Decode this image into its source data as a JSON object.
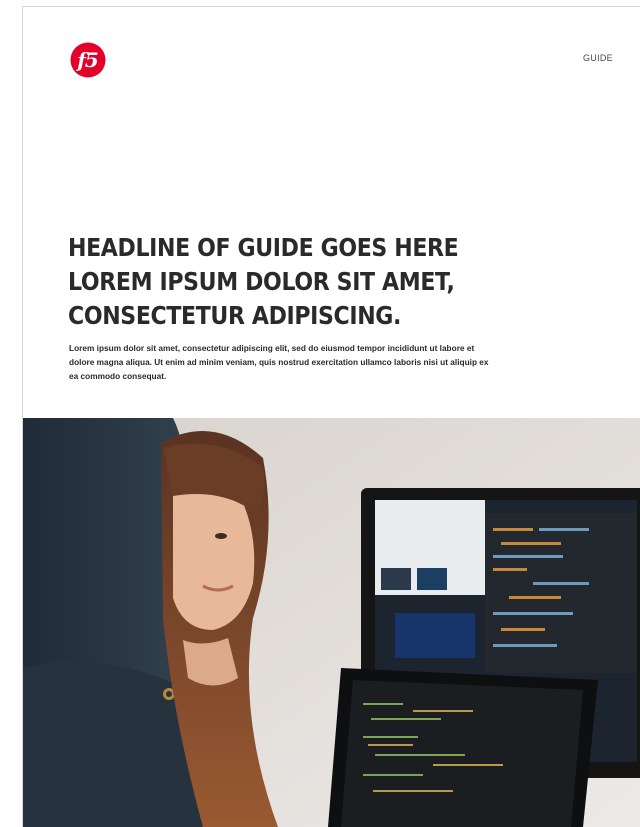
{
  "header": {
    "brand": "f5",
    "doc_type": "GUIDE"
  },
  "headline": {
    "lines": [
      "HEADLINE OF GUIDE GOES HERE",
      "LOREM IPSUM DOLOR SIT AMET,",
      "CONSECTETUR ADIPISCING."
    ]
  },
  "intro": {
    "text": "Lorem ipsum dolor sit amet, consectetur adipiscing elit, sed do eiusmod tempor incididunt ut labore et dolore magna aliqua. Ut enim ad minim veniam, quis nostrud exercitation ullamco laboris nisi ut aliquip ex ea commodo consequat."
  },
  "colors": {
    "brand_red": "#e4002b",
    "text_dark": "#2a2a2a"
  }
}
